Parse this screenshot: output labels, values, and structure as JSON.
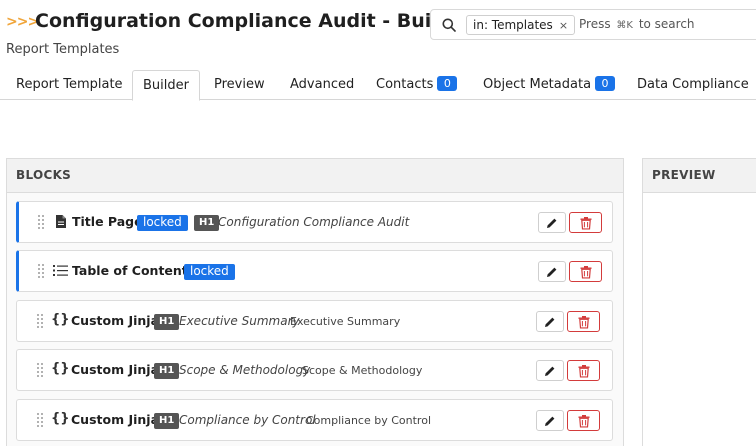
{
  "header": {
    "chevron": ">>>",
    "title": "Configuration Compliance Audit - Builder",
    "subtitle": "Report Templates"
  },
  "search": {
    "chip_label": "in: Templates",
    "chip_close": "×",
    "press_before": "Press",
    "shortcut": "⌘K",
    "press_after": "to search"
  },
  "tabs": [
    {
      "label": "Report Template",
      "count": null,
      "active": false
    },
    {
      "label": "Builder",
      "count": null,
      "active": true
    },
    {
      "label": "Preview",
      "count": null,
      "active": false
    },
    {
      "label": "Advanced",
      "count": null,
      "active": false
    },
    {
      "label": "Contacts",
      "count": "0",
      "active": false
    },
    {
      "label": "Object Metadata",
      "count": "0",
      "active": false
    },
    {
      "label": "Data Compliance",
      "count": null,
      "active": false
    }
  ],
  "panels": {
    "blocks_title": "BLOCKS",
    "preview_title": "PREVIEW"
  },
  "blocks": [
    {
      "name": "Title Page",
      "icon": "document-icon",
      "locked_label": "locked",
      "h_label": "H1",
      "heading": "Configuration Compliance Audit",
      "desc": ""
    },
    {
      "name": "Table of Contents",
      "icon": "list-icon",
      "locked_label": "locked",
      "h_label": "",
      "heading": "",
      "desc": ""
    },
    {
      "name": "Custom Jinja",
      "icon": "braces-icon",
      "locked_label": "",
      "h_label": "H1",
      "heading": "Executive Summary",
      "desc": "Executive Summary"
    },
    {
      "name": "Custom Jinja",
      "icon": "braces-icon",
      "locked_label": "",
      "h_label": "H1",
      "heading": "Scope & Methodology",
      "desc": "Scope & Methodology"
    },
    {
      "name": "Custom Jinja",
      "icon": "braces-icon",
      "locked_label": "",
      "h_label": "H1",
      "heading": "Compliance by Control",
      "desc": "Compliance by Control"
    }
  ],
  "colors": {
    "accent": "#1a73e8",
    "danger": "#d33b3b",
    "chevron": "#f0a53a"
  }
}
